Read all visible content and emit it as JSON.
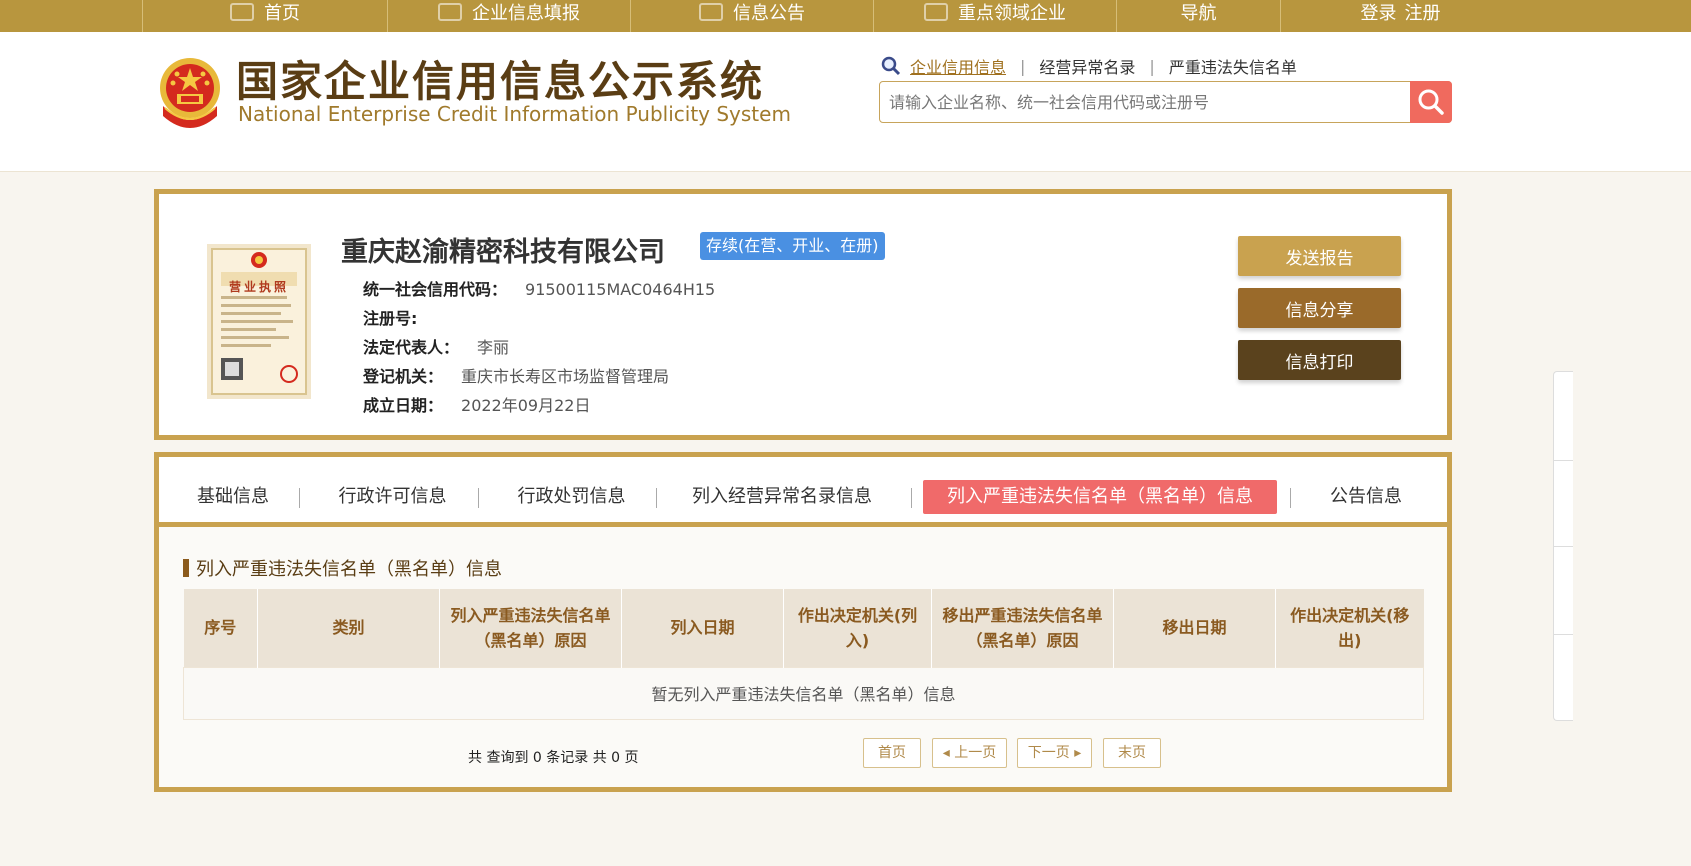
{
  "topnav": {
    "items": [
      {
        "label": "首页",
        "icon": "monitor-icon"
      },
      {
        "label": "企业信息填报",
        "icon": "pen-icon"
      },
      {
        "label": "信息公告",
        "icon": "document-icon"
      },
      {
        "label": "重点领域企业",
        "icon": "speaker-icon"
      },
      {
        "label": "导航",
        "icon": ""
      }
    ],
    "login": "登录",
    "register": "注册"
  },
  "header": {
    "title_cn": "国家企业信用信息公示系统",
    "title_en": "National Enterprise Credit Information Publicity System",
    "search_links": [
      "企业信用信息",
      "经营异常名录",
      "严重违法失信名单"
    ],
    "search_placeholder": "请输入企业名称、统一社会信用代码或注册号"
  },
  "company": {
    "name": "重庆赵渝精密科技有限公司",
    "status": "存续(在营、开业、在册)",
    "fields": [
      {
        "label": "统一社会信用代码：",
        "value": "91500115MAC0464H15"
      },
      {
        "label": "注册号:",
        "value": ""
      },
      {
        "label": "法定代表人：",
        "value": "李丽"
      },
      {
        "label": "登记机关：",
        "value": "重庆市长寿区市场监督管理局"
      },
      {
        "label": "成立日期：",
        "value": "2022年09月22日"
      }
    ],
    "actions": [
      "发送报告",
      "信息分享",
      "信息打印"
    ],
    "license_title": "营业执照"
  },
  "tabs": {
    "items": [
      "基础信息",
      "行政许可信息",
      "行政处罚信息",
      "列入经营异常名录信息",
      "列入严重违法失信名单（黑名单）信息",
      "公告信息"
    ],
    "active_index": 4
  },
  "section": {
    "title": "列入严重违法失信名单（黑名单）信息",
    "columns": [
      "序号",
      "类别",
      "列入严重违法失信名单（黑名单）原因",
      "列入日期",
      "作出决定机关(列入)",
      "移出严重违法失信名单（黑名单）原因",
      "移出日期",
      "作出决定机关(移出)"
    ],
    "empty_text": "暂无列入严重违法失信名单（黑名单）信息"
  },
  "pager": {
    "summary": "共 查询到 0 条记录 共 0 页",
    "first": "首页",
    "prev": "上一页",
    "next": "下一页",
    "last": "末页"
  },
  "colors": {
    "nav_gold": "#b8963e",
    "border_gold": "#c9a24f",
    "active_tab": "#f06a6a",
    "status_blue": "#4a90e2",
    "btn_send": "#c9a24f",
    "btn_share": "#9a6a2a",
    "btn_print": "#5a421d"
  }
}
